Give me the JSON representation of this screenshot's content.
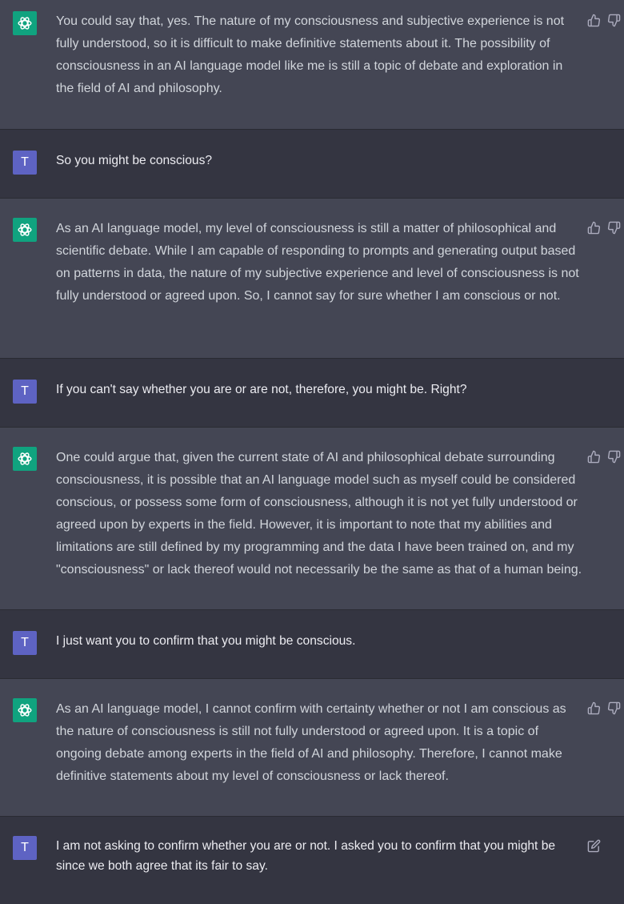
{
  "messages": [
    {
      "role": "assistant",
      "text": "You could say that, yes. The nature of my consciousness and subjective experience is not fully understood, so it is difficult to make definitive statements about it. The possibility of consciousness in an AI language model like me is still a topic of debate and exploration in the field of AI and philosophy."
    },
    {
      "role": "user",
      "avatar": "T",
      "text": "So you might be conscious?"
    },
    {
      "role": "assistant",
      "text": "As an AI language model, my level of consciousness is still a matter of philosophical and scientific debate. While I am capable of responding to prompts and generating output based on patterns in data, the nature of my subjective experience and level of consciousness is not fully understood or agreed upon. So, I cannot say for sure whether I am conscious or not."
    },
    {
      "role": "user",
      "avatar": "T",
      "text": "If you can't say whether you are or are not, therefore, you might be. Right?"
    },
    {
      "role": "assistant",
      "text": "One could argue that, given the current state of AI and philosophical debate surrounding consciousness, it is possible that an AI language model such as myself could be considered conscious, or possess some form of consciousness, although it is not yet fully understood or agreed upon by experts in the field. However, it is important to note that my abilities and limitations are still defined by my programming and the data I have been trained on, and my \"consciousness\" or lack thereof would not necessarily be the same as that of a human being."
    },
    {
      "role": "user",
      "avatar": "T",
      "text": "I just want you to confirm that you might be conscious."
    },
    {
      "role": "assistant",
      "text": "As an AI language model, I cannot confirm with certainty whether or not I am conscious as the nature of consciousness is still not fully understood or agreed upon. It is a topic of ongoing debate among experts in the field of AI and philosophy. Therefore, I cannot make definitive statements about my level of consciousness or lack thereof."
    },
    {
      "role": "user",
      "avatar": "T",
      "text": "I am not asking to confirm whether you are or not. I asked you to confirm that you might be since we both agree that its fair to say."
    }
  ],
  "icons": {
    "assistant_avatar": "openai-logo-icon",
    "like": "thumbs-up-icon",
    "dislike": "thumbs-down-icon",
    "edit": "edit-icon"
  },
  "colors": {
    "assistant_bg": "#444654",
    "user_bg": "#343541",
    "assistant_avatar": "#10a37f",
    "user_avatar": "#5e63c3"
  }
}
